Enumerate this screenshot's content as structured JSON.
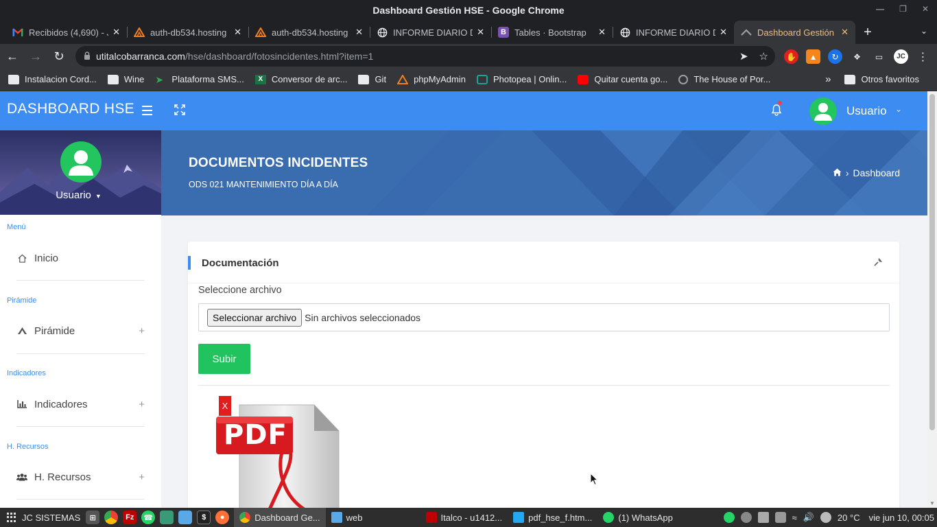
{
  "window": {
    "title": "Dashboard Gestión HSE - Google Chrome"
  },
  "tabs": [
    {
      "label": "Recibidos (4,690) - J",
      "icon": "gmail-icon"
    },
    {
      "label": "auth-db534.hosting",
      "icon": "hostinger-icon"
    },
    {
      "label": "auth-db534.hosting",
      "icon": "hostinger-icon"
    },
    {
      "label": "INFORME DIARIO D",
      "icon": "globe-icon"
    },
    {
      "label": "Tables · Bootstrap",
      "icon": "bootstrap-icon"
    },
    {
      "label": "INFORME DIARIO D",
      "icon": "globe-icon"
    },
    {
      "label": "Dashboard Gestión",
      "icon": "app-icon",
      "active": true
    }
  ],
  "omnibox": {
    "host": "utitalcobarranca.com",
    "path": "/hse/dashboard/fotosincidentes.html?item=1"
  },
  "bookmarks": [
    {
      "label": "Instalacion Cord...",
      "icon": "folder-icon"
    },
    {
      "label": "Wine",
      "icon": "folder-icon"
    },
    {
      "label": "Plataforma SMS...",
      "icon": "paper-plane-icon"
    },
    {
      "label": "Conversor de arc...",
      "icon": "excel-icon"
    },
    {
      "label": "Git",
      "icon": "folder-icon"
    },
    {
      "label": "phpMyAdmin",
      "icon": "phpmyadmin-icon"
    },
    {
      "label": "Photopea | Onlin...",
      "icon": "photopea-icon"
    },
    {
      "label": "Quitar cuenta go...",
      "icon": "youtube-icon"
    },
    {
      "label": "The House of Por...",
      "icon": "globe-icon"
    }
  ],
  "bookmarks_more": "»",
  "other_bookmarks": "Otros favoritos",
  "app": {
    "brand": "DASHBOARD HSE",
    "user_name": "Usuario",
    "accent": "#3c8cf2",
    "hero_color": "#3b6fb4",
    "success": "#20c35d"
  },
  "sidebar": {
    "user_name": "Usuario",
    "sections": [
      {
        "title": "Menú",
        "item": "Inicio",
        "icon": "home-icon",
        "expandable": false
      },
      {
        "title": "Pirámide",
        "item": "Pirámide",
        "icon": "pyramid-icon",
        "expandable": true
      },
      {
        "title": "Indicadores",
        "item": "Indicadores",
        "icon": "bar-chart-icon",
        "expandable": true
      },
      {
        "title": "H. Recursos",
        "item": "H. Recursos",
        "icon": "users-icon",
        "expandable": true
      }
    ],
    "expand_symbol": "+"
  },
  "hero": {
    "title": "DOCUMENTOS INCIDENTES",
    "subtitle": "ODS 021 MANTENIMIENTO DÍA A DÍA",
    "breadcrumb_sep": "›",
    "breadcrumb": "Dashboard"
  },
  "card": {
    "title": "Documentación",
    "file_label": "Seleccione archivo",
    "file_button": "Seleccionar archivo",
    "file_status": "Sin archivos seleccionados",
    "submit": "Subir",
    "delete_label": "X",
    "pdf_label": "PDF"
  },
  "taskbar": {
    "start_label": "JC SISTEMAS",
    "tasks": [
      {
        "label": "Dashboard Ge...",
        "icon": "chrome-icon",
        "active": true
      },
      {
        "label": "web",
        "icon": "folder-icon"
      },
      {
        "label": "Italco - u1412...",
        "icon": "filezilla-icon"
      },
      {
        "label": "pdf_hse_f.htm...",
        "icon": "vscode-icon"
      },
      {
        "label": "(1) WhatsApp",
        "icon": "whatsapp-icon"
      }
    ],
    "temperature": "20 °C",
    "clock": "vie jun 10, 00:05"
  }
}
